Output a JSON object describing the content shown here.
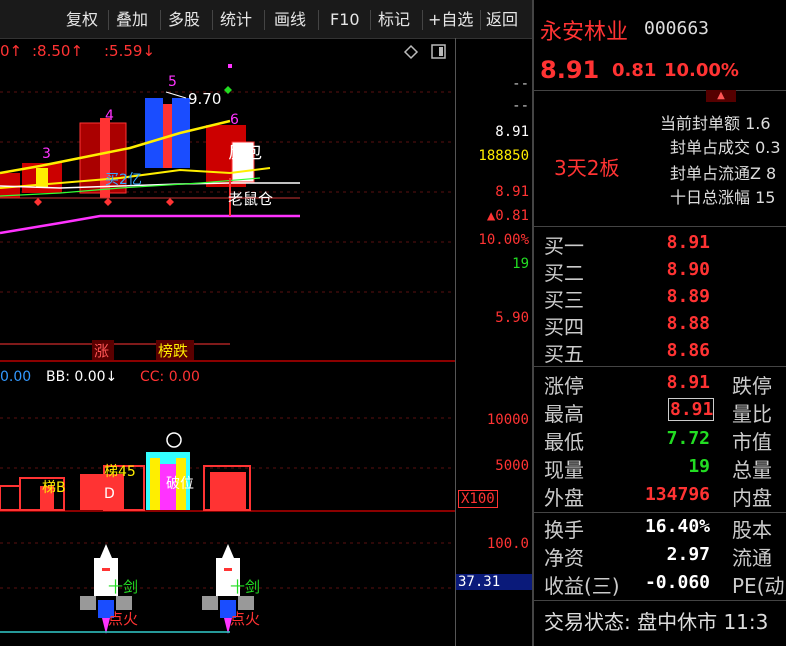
{
  "toolbar": {
    "items": [
      "复权",
      "叠加",
      "多股",
      "统计",
      "画线",
      "F10",
      "标记",
      "+自选",
      "返回"
    ]
  },
  "main_chart": {
    "header": {
      "v1": "0↑",
      "v2": ":8.50↑",
      "v3": ":5.59↓"
    },
    "annotations": {
      "peak": "9.70",
      "candle_nums": [
        "3",
        "4",
        "5",
        "6"
      ],
      "fanbao": "反包",
      "buy_label": "买2亿",
      "risk_label": "老鼠仓",
      "zhang": "涨",
      "bangdie": "榜跌"
    }
  },
  "main_axis": {
    "top1": "--",
    "top2": "--",
    "price": "8.91",
    "vol": "188850",
    "price2": "8.91",
    "change": "▲0.81",
    "pct": "10.00%",
    "num": "19",
    "low": "5.90"
  },
  "sub_chart": {
    "header": {
      "aa": "0.00",
      "bb": "BB: 0.00↓",
      "cc": "CC: 0.00"
    },
    "axis": {
      "v1": "10000",
      "v2": "5000",
      "mult": "X100"
    },
    "labels": {
      "ti_b": "梯B",
      "ti45": "梯45",
      "d": "D",
      "break": "破位"
    }
  },
  "rocket_chart": {
    "axis": {
      "v1": "100.0",
      "v2": "37.31"
    },
    "labels": {
      "sword1": "十剑",
      "sword2": "十剑",
      "fire1": "点火",
      "fire2": "点火"
    }
  },
  "panel": {
    "stock_name": "永安林业",
    "stock_code": "000663",
    "price": "8.91",
    "change": "0.81",
    "pct": "10.00%",
    "board": "3天2板",
    "stats": [
      "当前封单额 1.6",
      "封单占成交 0.3",
      "封单占流通Z 8",
      "十日总涨幅 15"
    ],
    "bids": [
      {
        "label": "买一",
        "price": "8.91"
      },
      {
        "label": "买二",
        "price": "8.90"
      },
      {
        "label": "买三",
        "price": "8.89"
      },
      {
        "label": "买四",
        "price": "8.88"
      },
      {
        "label": "买五",
        "price": "8.86"
      }
    ],
    "quotes": [
      {
        "label": "涨停",
        "value": "8.91",
        "right": "跌停"
      },
      {
        "label": "最高",
        "value": "8.91",
        "right": "量比"
      },
      {
        "label": "最低",
        "value": "7.72",
        "right": "市值"
      },
      {
        "label": "现量",
        "value": "19",
        "right": "总量"
      },
      {
        "label": "外盘",
        "value": "134796",
        "right": "内盘"
      }
    ],
    "fundamentals": [
      {
        "label": "换手",
        "value": "16.40%",
        "right": "股本"
      },
      {
        "label": "净资",
        "value": "2.97",
        "right": "流通"
      },
      {
        "label": "收益(三)",
        "value": "-0.060",
        "right": "PE(动"
      }
    ],
    "status": "交易状态: 盘中休市 11:3"
  },
  "colors": {
    "red": "#ff3333",
    "green": "#22dd22",
    "yellow": "#ffee00",
    "blue": "#1a4dff",
    "magenta": "#ff33ff",
    "cyan": "#33ffff"
  }
}
